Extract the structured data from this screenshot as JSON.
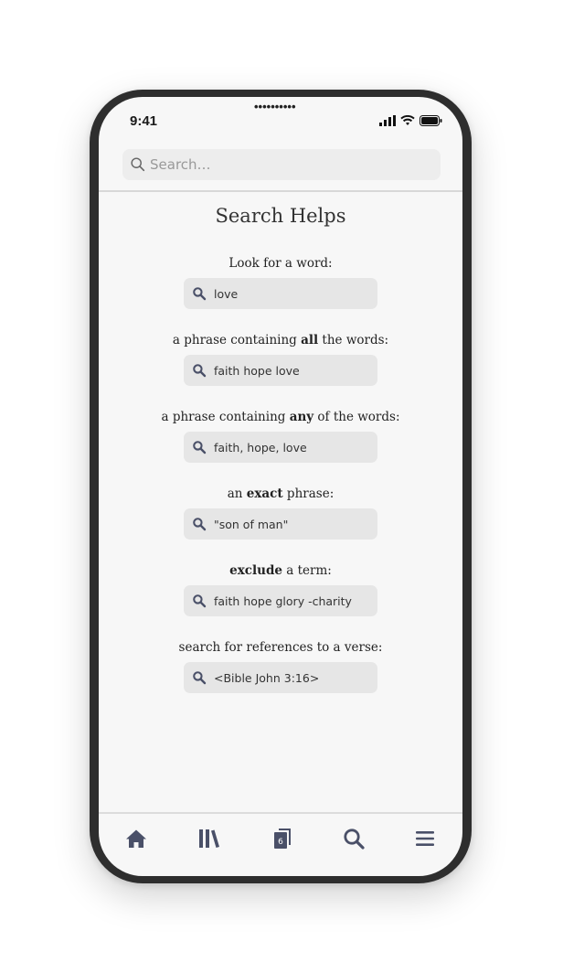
{
  "status_bar": {
    "time": "9:41",
    "notch": "••••••••••"
  },
  "search": {
    "placeholder": "Search…"
  },
  "page": {
    "title": "Search Helps"
  },
  "helps": [
    {
      "pre": "Look for a word:",
      "bold": "",
      "post": "",
      "example": "love"
    },
    {
      "pre": "a phrase containing ",
      "bold": "all",
      "post": " the words:",
      "example": "faith hope love"
    },
    {
      "pre": "a phrase containing ",
      "bold": "any",
      "post": " of the words:",
      "example": "faith, hope, love"
    },
    {
      "pre": "an ",
      "bold": "exact",
      "post": " phrase:",
      "example": "\"son of man\""
    },
    {
      "pre": "",
      "bold": "exclude",
      "post": " a term:",
      "example": "faith hope glory -charity"
    },
    {
      "pre": "search for references to a verse:",
      "bold": "",
      "post": "",
      "example": "<Bible John 3:16>"
    }
  ],
  "tabbar": {
    "items": [
      {
        "icon": "home-icon"
      },
      {
        "icon": "library-icon"
      },
      {
        "icon": "tabs-icon",
        "badge": "6"
      },
      {
        "icon": "search-icon"
      },
      {
        "icon": "menu-icon"
      }
    ]
  },
  "colors": {
    "icon": "#4a5068",
    "background": "#f7f7f7",
    "field": "#e6e6e6"
  }
}
